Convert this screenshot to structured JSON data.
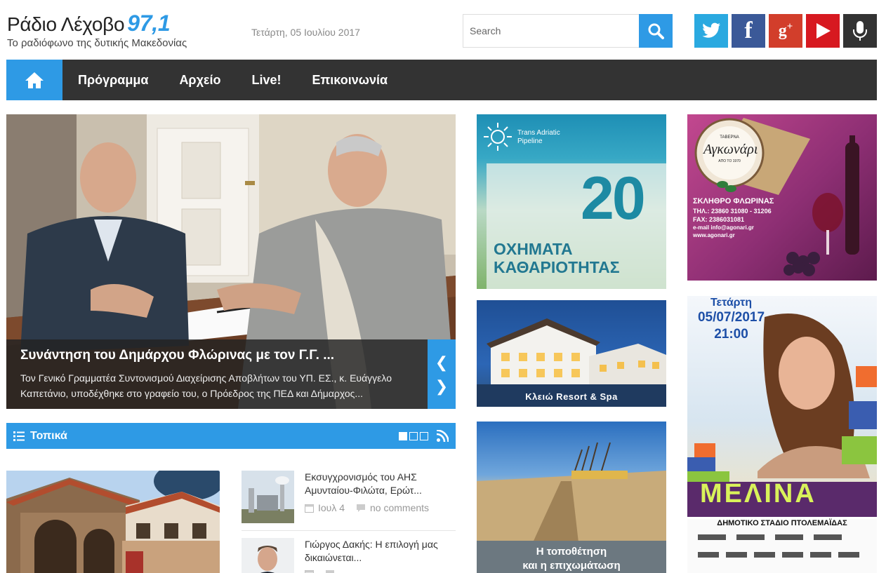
{
  "site": {
    "title": "Ράδιο Λέχοβο",
    "frequency": "97,1",
    "tagline": "Το ραδιόφωνο της δυτικής Μακεδονίας",
    "date": "Τετάρτη, 05 Ιουλίου 2017"
  },
  "search": {
    "placeholder": "Search"
  },
  "social": [
    "twitter-icon",
    "facebook-icon",
    "google-plus-icon",
    "youtube-icon",
    "microphone-icon"
  ],
  "nav": {
    "items": [
      "Πρόγραμμα",
      "Αρχείο",
      "Live!",
      "Επικοινωνία"
    ]
  },
  "slider": {
    "title": "Συνάντηση του Δημάρχου Φλώρινας με τον Γ.Γ. ...",
    "excerpt": "Τον Γενικό Γραμματέα Συντονισμού Διαχείρισης Αποβλήτων του ΥΠ. ΕΣ., κ. Ευάγγελο Καπετάνιο, υποδέχθηκε στο γραφείο του, ο Πρόεδρος της ΠΕΔ και Δήμαρχος..."
  },
  "section": {
    "title": "Τοπικά"
  },
  "list": [
    {
      "title": "Εκσυγχρονισμός του ΑΗΣ Αμυνταίου-Φιλώτα, Ερώτ...",
      "date": "Ιουλ 4",
      "comments": "no comments"
    },
    {
      "title": "Γιώργος Δακής: Η επιλογή μας δικαιώνεται...",
      "date": "",
      "comments": ""
    }
  ],
  "ads": {
    "tap": {
      "brand": "Trans Adriatic Pipeline",
      "number": "20",
      "line1": "ΟΧΗΜΑΤΑ",
      "line2": "ΚΑΘΑΡΙΟΤΗΤΑΣ"
    },
    "resort": {
      "label": "Κλειώ Resort & Spa"
    },
    "pipeline": {
      "line1": "Η τοποθέτηση",
      "line2": "και η επιχωμάτωση"
    },
    "taverna": {
      "sign1": "ΤΑΒΕΡΝΑ",
      "sign2": "Αγκωνάρι",
      "sign3": "ΑΠΟ ΤΟ 1970",
      "place": "ΣΚΛΗΘΡΟ ΦΛΩΡΙΝΑΣ",
      "tel": "ΤΗΛ.: 23860 31080 - 31206",
      "fax": "FAX: 2386031081",
      "email": "e-mail info@agonari.gr",
      "web": "www.agonari.gr"
    },
    "concert": {
      "day": "Τετάρτη",
      "date": "05/07/2017",
      "time": "21:00",
      "artist": "ΜΕΛΙΝΑ",
      "venue": "ΔΗΜΟΤΙΚΟ ΣΤΑΔΙΟ ΠΤΟΛΕΜΑΪΔΑΣ"
    }
  },
  "colors": {
    "accent": "#2e9ae5",
    "nav_bg": "#333333"
  }
}
